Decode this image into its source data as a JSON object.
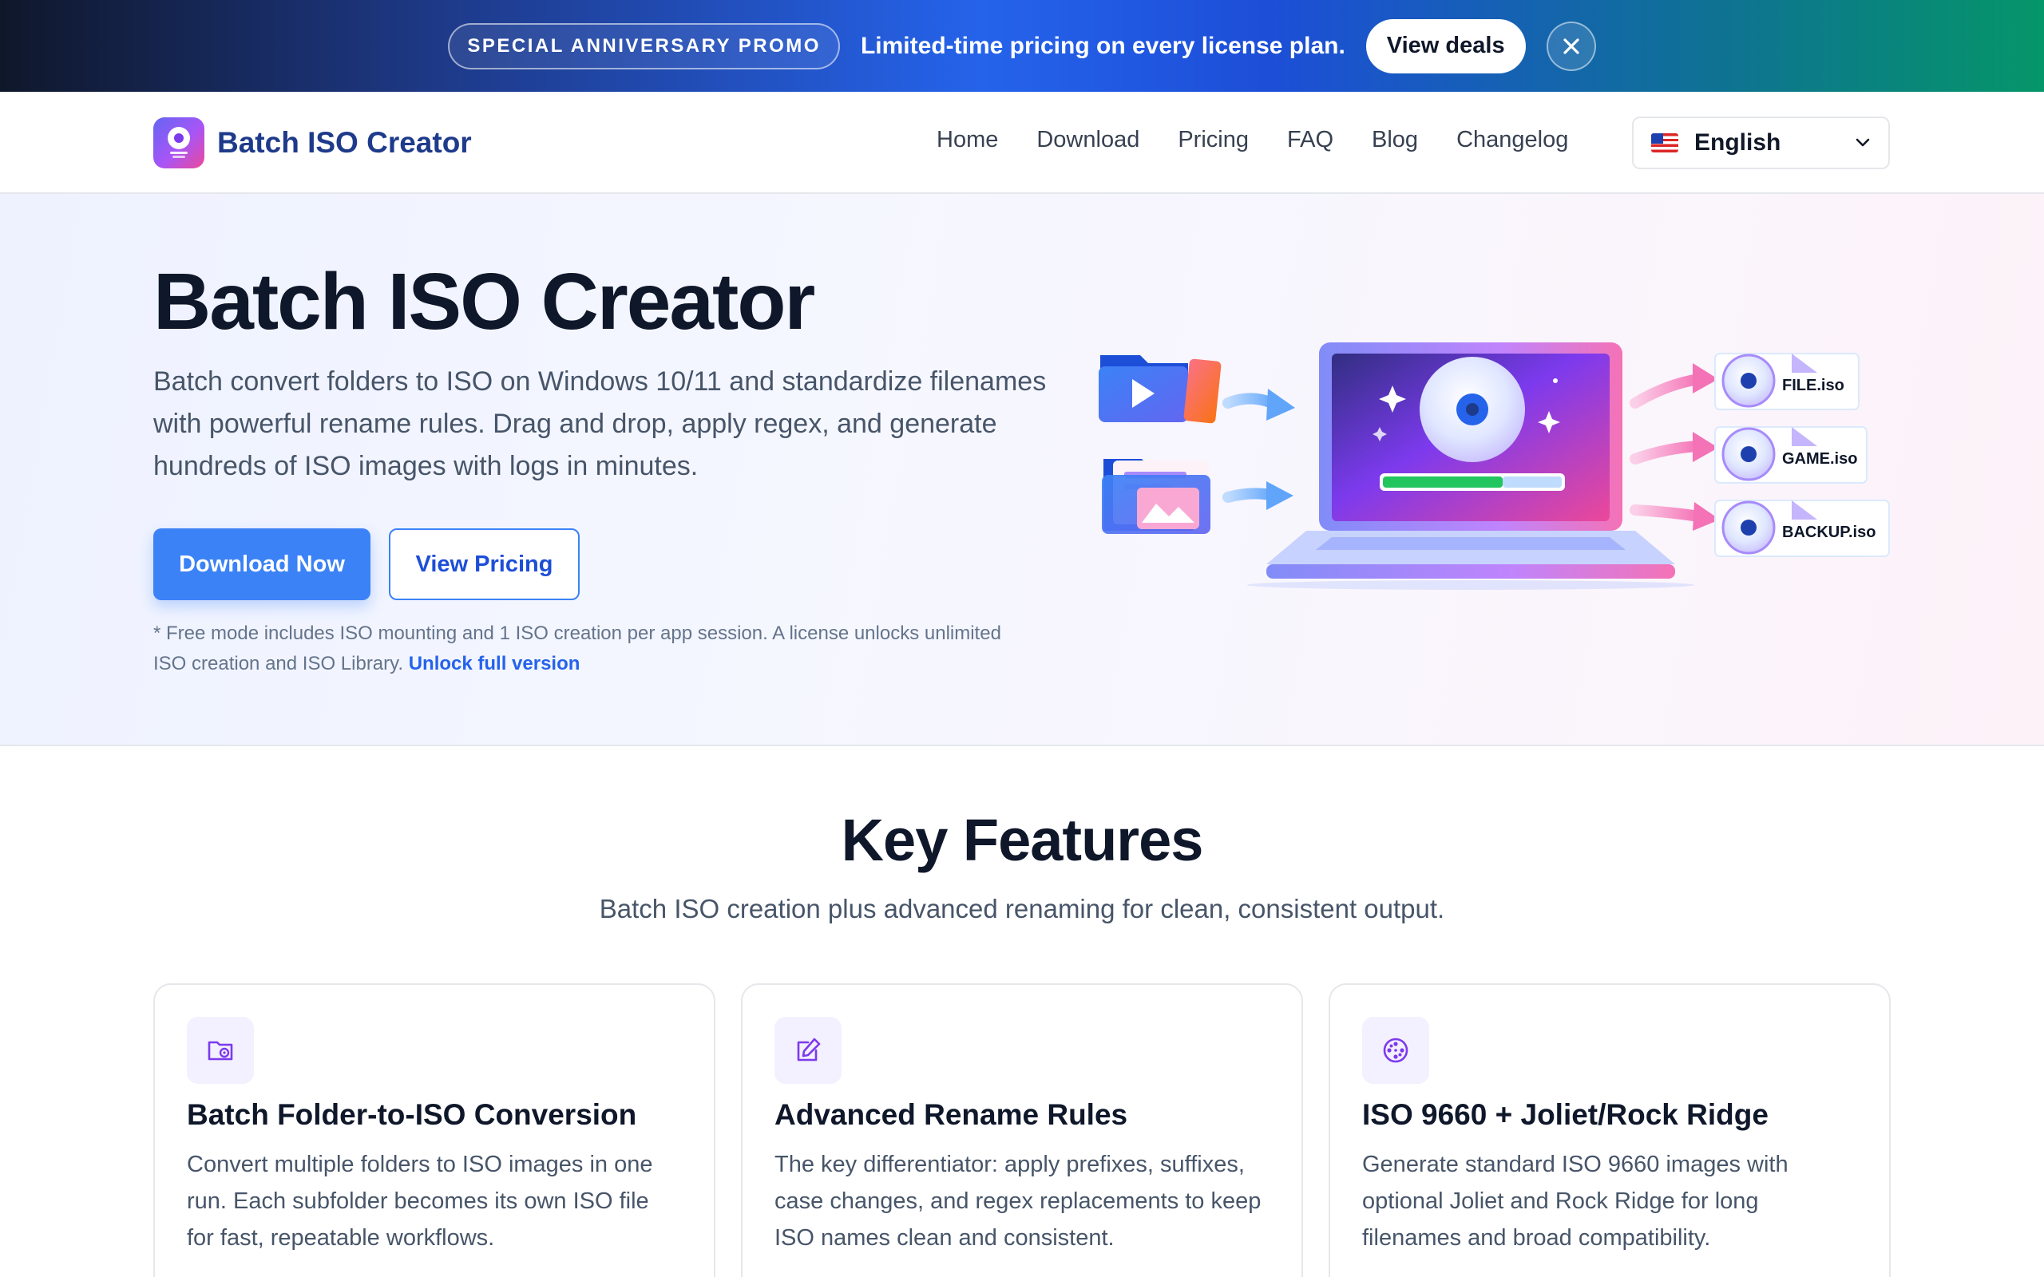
{
  "promo": {
    "badge": "SPECIAL ANNIVERSARY PROMO",
    "text": "Limited-time pricing on every license plan.",
    "cta": "View deals",
    "close_icon": "close-icon"
  },
  "nav": {
    "brand_name": "Batch ISO Creator",
    "brand_icon": "disc-logo-icon",
    "links": [
      "Home",
      "Download",
      "Pricing",
      "FAQ",
      "Blog",
      "Changelog"
    ],
    "language": "English",
    "language_flag": "us-flag-icon",
    "language_chevron": "chevron-down-icon"
  },
  "hero": {
    "title": "Batch ISO Creator",
    "description": "Batch convert folders to ISO on Windows 10/11 and standardize filenames with powerful rename rules. Drag and drop, apply regex, and generate hundreds of ISO images with logs in minutes.",
    "primary_cta": "Download Now",
    "secondary_cta": "View Pricing",
    "note": "* Free mode includes ISO mounting and 1 ISO creation per app session. A license unlocks unlimited ISO creation and ISO Library.",
    "note_link": "Unlock full version",
    "illustration": {
      "files": [
        "FILE.iso",
        "GAME.iso",
        "BACKUP.iso"
      ]
    }
  },
  "features": {
    "title": "Key Features",
    "subtitle": "Batch ISO creation plus advanced renaming for clean, consistent output.",
    "cards": [
      {
        "icon": "folder-disc-icon",
        "title": "Batch Folder-to-ISO Conversion",
        "description": "Convert multiple folders to ISO images in one run. Each subfolder becomes its own ISO file for fast, repeatable workflows."
      },
      {
        "icon": "edit-icon",
        "title": "Advanced Rename Rules",
        "description": "The key differentiator: apply prefixes, suffixes, case changes, and regex replacements to keep ISO names clean and consistent."
      },
      {
        "icon": "film-reel-icon",
        "title": "ISO 9660 + Joliet/Rock Ridge",
        "description": "Generate standard ISO 9660 images with optional Joliet and Rock Ridge for long filenames and broad compatibility."
      }
    ]
  },
  "colors": {
    "accent": "#3b82f6",
    "brand": "#1e3a8a",
    "icon_purple": "#7c3aed"
  }
}
